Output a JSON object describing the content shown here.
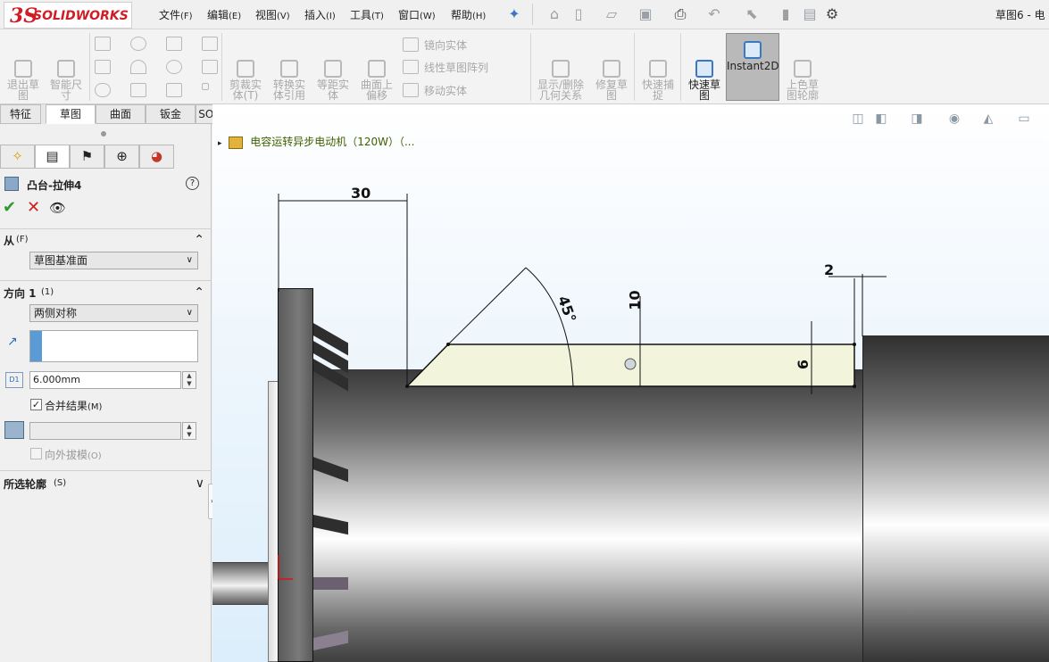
{
  "app": {
    "logo_ds": "3S",
    "logo_text": "SOLIDWORKS",
    "document_title": "草图6 - 电"
  },
  "menu": [
    {
      "label": "文件",
      "hotkey": "(F)"
    },
    {
      "label": "编辑",
      "hotkey": "(E)"
    },
    {
      "label": "视图",
      "hotkey": "(V)"
    },
    {
      "label": "插入",
      "hotkey": "(I)"
    },
    {
      "label": "工具",
      "hotkey": "(T)"
    },
    {
      "label": "窗口",
      "hotkey": "(W)"
    },
    {
      "label": "帮助",
      "hotkey": "(H)"
    }
  ],
  "command_manager": {
    "exit_sketch": "退出草\n图",
    "smart_dimension": "智能尺\n寸",
    "trim_entities": "剪裁实\n体(T)",
    "convert_entities": "转换实\n体引用",
    "offset_entities": "等距实\n体",
    "offset_on_surface": "曲面上\n偏移",
    "mirror_entities": "镜向实体",
    "linear_pattern": "线性草图阵列",
    "move_entities": "移动实体",
    "display_relations": "显示/删除\n几何关系",
    "repair_sketch": "修复草\n图",
    "quick_snaps": "快速捕\n捉",
    "rapid_sketch": "快速草\n图",
    "instant2d": "Instant2D",
    "shaded_sketch": "上色草\n图轮廓"
  },
  "tabs": [
    "特征",
    "草图",
    "曲面",
    "钣金",
    "SOLIDWORKS 插件"
  ],
  "active_tab": "草图",
  "property_manager": {
    "title": "凸台-拉伸4",
    "help": "?",
    "from_section": {
      "label": "从",
      "hotkey": "(F)",
      "value": "草图基准面"
    },
    "direction1": {
      "label": "方向 1",
      "hotkey": "(1)",
      "end_condition": "两侧对称",
      "depth": "6.000mm",
      "merge_result": "合并结果",
      "merge_hotkey": "(M)",
      "merge_checked": true,
      "draft_outward": "向外拔模",
      "draft_hotkey": "(O)"
    },
    "selected_contours": {
      "label": "所选轮廓",
      "hotkey": "(S)"
    }
  },
  "viewport": {
    "tree_item": "电容运转异步电动机（120W）（...",
    "dimensions": {
      "width": "30",
      "angle": "45°",
      "height": "10",
      "thickness": "6",
      "gap": "2"
    }
  },
  "colors": {
    "brand_red": "#d01c24",
    "sketch_fill": "#f2f5dc",
    "accept_green": "#2e9a2e",
    "cancel_red": "#d0201e"
  }
}
